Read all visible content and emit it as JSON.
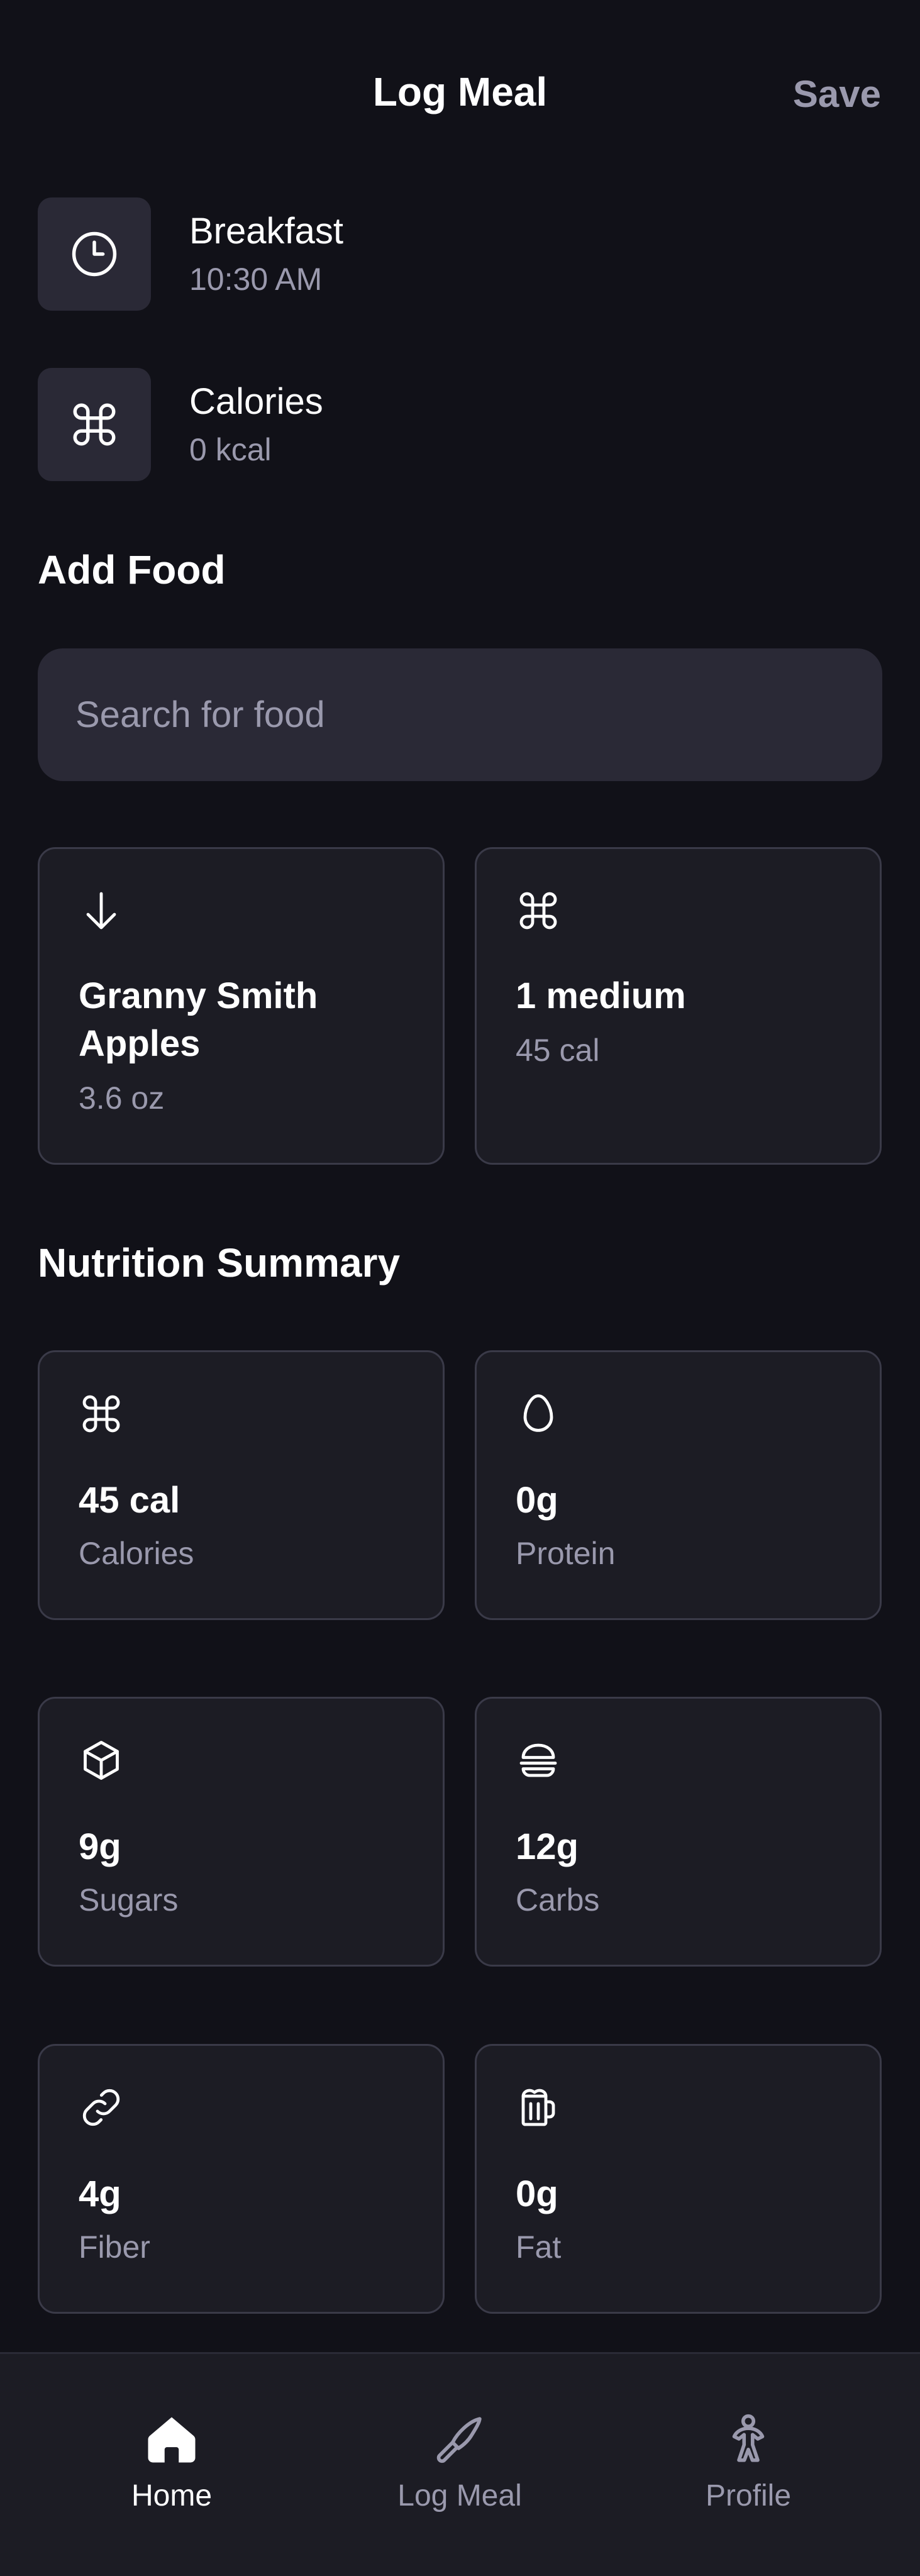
{
  "header": {
    "title": "Log Meal",
    "save_label": "Save"
  },
  "meal": {
    "name": "Breakfast",
    "time": "10:30 AM",
    "icon": "clock-icon"
  },
  "calories_row": {
    "title": "Calories",
    "value": "0 kcal",
    "icon": "command-icon"
  },
  "add_food": {
    "title": "Add Food",
    "search_placeholder": "Search for food",
    "items": [
      {
        "name": "Granny Smith Apples",
        "detail": "3.6 oz",
        "icon": "arrow-down-icon"
      },
      {
        "name": "1 medium",
        "detail": "45 cal",
        "icon": "command-icon"
      }
    ]
  },
  "nutrition": {
    "title": "Nutrition Summary",
    "stats": [
      {
        "value": "45 cal",
        "label": "Calories",
        "icon": "command-icon"
      },
      {
        "value": "0g",
        "label": "Protein",
        "icon": "egg-icon"
      },
      {
        "value": "9g",
        "label": "Sugars",
        "icon": "cube-icon"
      },
      {
        "value": "12g",
        "label": "Carbs",
        "icon": "burger-icon"
      },
      {
        "value": "4g",
        "label": "Fiber",
        "icon": "link-icon"
      },
      {
        "value": "0g",
        "label": "Fat",
        "icon": "beer-mug-icon"
      }
    ]
  },
  "nav": {
    "items": [
      {
        "label": "Home",
        "icon": "home-icon",
        "active": true
      },
      {
        "label": "Log Meal",
        "icon": "knife-icon",
        "active": false
      },
      {
        "label": "Profile",
        "icon": "person-icon",
        "active": false
      }
    ]
  },
  "colors": {
    "background": "#111118",
    "card": "#1c1c24",
    "field": "#2a2936",
    "muted_text": "#9a99ad",
    "active_nav": "#ffffff"
  }
}
